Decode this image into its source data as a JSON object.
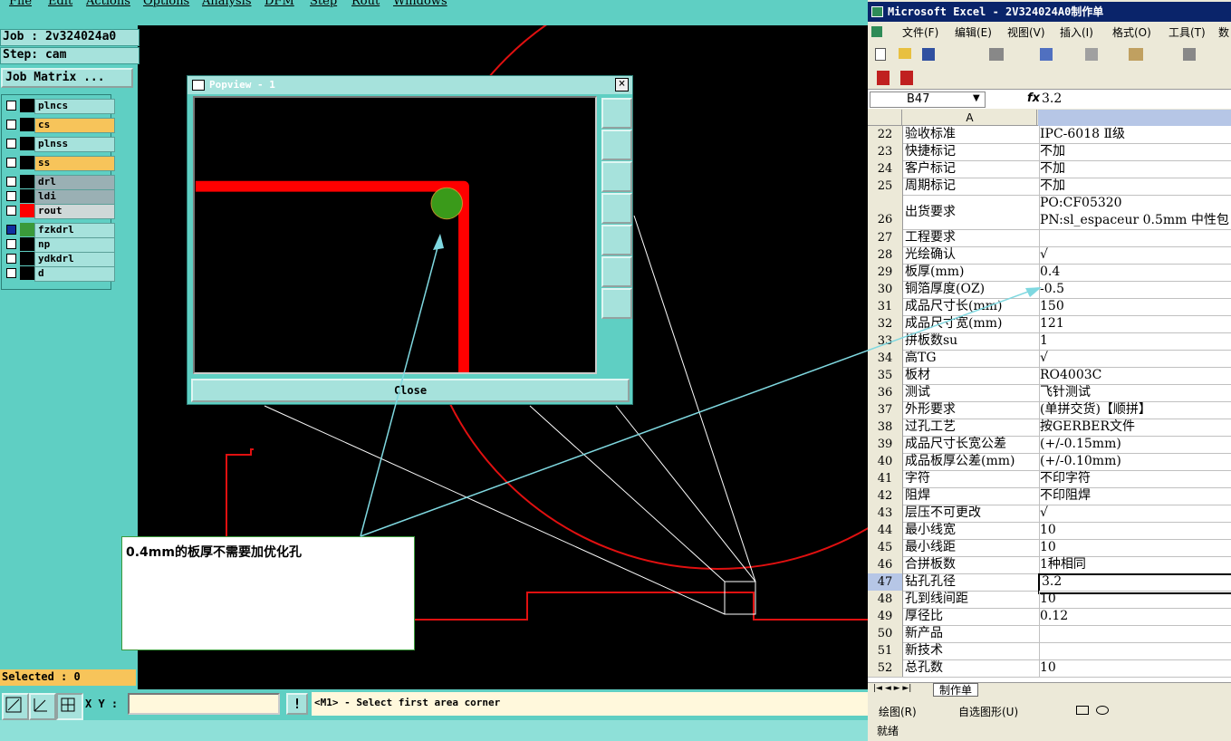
{
  "cam": {
    "menu": [
      "File",
      "Edit",
      "Actions",
      "Options",
      "Analysis",
      "DFM",
      "Step",
      "Rout",
      "Windows"
    ],
    "job_line": "Job : 2v324024a0",
    "step_line": "Step: cam",
    "job_matrix_label": "Job Matrix ...",
    "layers": [
      {
        "name": "plncs",
        "color": "#000000",
        "name_bg": "#a6e2dc"
      },
      {
        "name": "cs",
        "color": "#000000",
        "name_bg": "#f7c45a"
      },
      {
        "name": "plnss",
        "color": "#000000",
        "name_bg": "#a6e2dc"
      },
      {
        "name": "ss",
        "color": "#000000",
        "name_bg": "#f7c45a"
      },
      {
        "name": "drl",
        "color": "#000000",
        "name_bg": "#9ab0b4"
      },
      {
        "name": "ldi",
        "color": "#000000",
        "name_bg": "#9ab0b4"
      },
      {
        "name": "rout",
        "color": "#ff0000",
        "name_bg": "#cfd8d8"
      },
      {
        "name": "fzkdrl",
        "color": "#3a9a3a",
        "name_bg": "#a6e2dc"
      },
      {
        "name": "np",
        "color": "#000000",
        "name_bg": "#a6e2dc"
      },
      {
        "name": "ydkdrl",
        "color": "#000000",
        "name_bg": "#a6e2dc"
      },
      {
        "name": "d",
        "color": "#000000",
        "name_bg": "#a6e2dc"
      }
    ],
    "selected_text": "Selected : 0",
    "xy_label": "X Y :",
    "warn_label": "!",
    "prompt_text": "<M1> - Select first area corner"
  },
  "popview": {
    "title": "Popview - 1",
    "close_label": "Close"
  },
  "callout": {
    "text": "0.4mm的板厚不需要加优化孔"
  },
  "excel": {
    "title": "Microsoft Excel - 2V324024A0制作单",
    "menu": [
      "文件(F)",
      "编辑(E)",
      "视图(V)",
      "插入(I)",
      "格式(O)",
      "工具(T)",
      "数"
    ],
    "name_box": "B47",
    "fx": "fx",
    "formula_value": "3.2",
    "column_a": "A",
    "rows": [
      {
        "n": "22",
        "a": "验收标准",
        "b": "IPC-6018 Ⅱ级"
      },
      {
        "n": "23",
        "a": "快捷标记",
        "b": "不加"
      },
      {
        "n": "24",
        "a": "客户标记",
        "b": "不加"
      },
      {
        "n": "25",
        "a": "周期标记",
        "b": "不加"
      },
      {
        "n": "26",
        "a": "出货要求",
        "b": "PO:CF05320",
        "b2": "PN:sl_espaceur 0.5mm 中性包"
      },
      {
        "n": "27",
        "a": "工程要求",
        "b": ""
      },
      {
        "n": "28",
        "a": "光绘确认",
        "b": "√"
      },
      {
        "n": "29",
        "a": "板厚(mm)",
        "b": "0.4"
      },
      {
        "n": "30",
        "a": "铜箔厚度(OZ)",
        "b": "-0.5"
      },
      {
        "n": "31",
        "a": "成品尺寸长(mm)",
        "b": "150"
      },
      {
        "n": "32",
        "a": "成品尺寸宽(mm)",
        "b": "121"
      },
      {
        "n": "33",
        "a": "拼板数su",
        "b": "1"
      },
      {
        "n": "34",
        "a": "高TG",
        "b": "√"
      },
      {
        "n": "35",
        "a": "板材",
        "b": "RO4003C"
      },
      {
        "n": "36",
        "a": "测试",
        "b": "飞针测试"
      },
      {
        "n": "37",
        "a": "外形要求",
        "b": "(单拼交货)【顺拼】"
      },
      {
        "n": "38",
        "a": "过孔工艺",
        "b": "按GERBER文件"
      },
      {
        "n": "39",
        "a": "成品尺寸长宽公差",
        "b": "(+/-0.15mm)"
      },
      {
        "n": "40",
        "a": "成品板厚公差(mm)",
        "b": "(+/-0.10mm)"
      },
      {
        "n": "41",
        "a": "字符",
        "b": "不印字符"
      },
      {
        "n": "42",
        "a": "阻焊",
        "b": "不印阻焊"
      },
      {
        "n": "43",
        "a": "层压不可更改",
        "b": "√"
      },
      {
        "n": "44",
        "a": "最小线宽",
        "b": "10"
      },
      {
        "n": "45",
        "a": "最小线距",
        "b": "10"
      },
      {
        "n": "46",
        "a": "合拼板数",
        "b": "1种相同"
      },
      {
        "n": "47",
        "a": "钻孔孔径",
        "b": "3.2"
      },
      {
        "n": "48",
        "a": "孔到线间距",
        "b": "10"
      },
      {
        "n": "49",
        "a": "厚径比",
        "b": "0.12"
      },
      {
        "n": "50",
        "a": "新产品",
        "b": ""
      },
      {
        "n": "51",
        "a": "新技术",
        "b": ""
      },
      {
        "n": "52",
        "a": "总孔数",
        "b": "10"
      }
    ],
    "sheet_tab": "制作单",
    "draw_label": "绘图(R)",
    "autoshape_label": "自选图形(U)",
    "status": "就绪"
  }
}
